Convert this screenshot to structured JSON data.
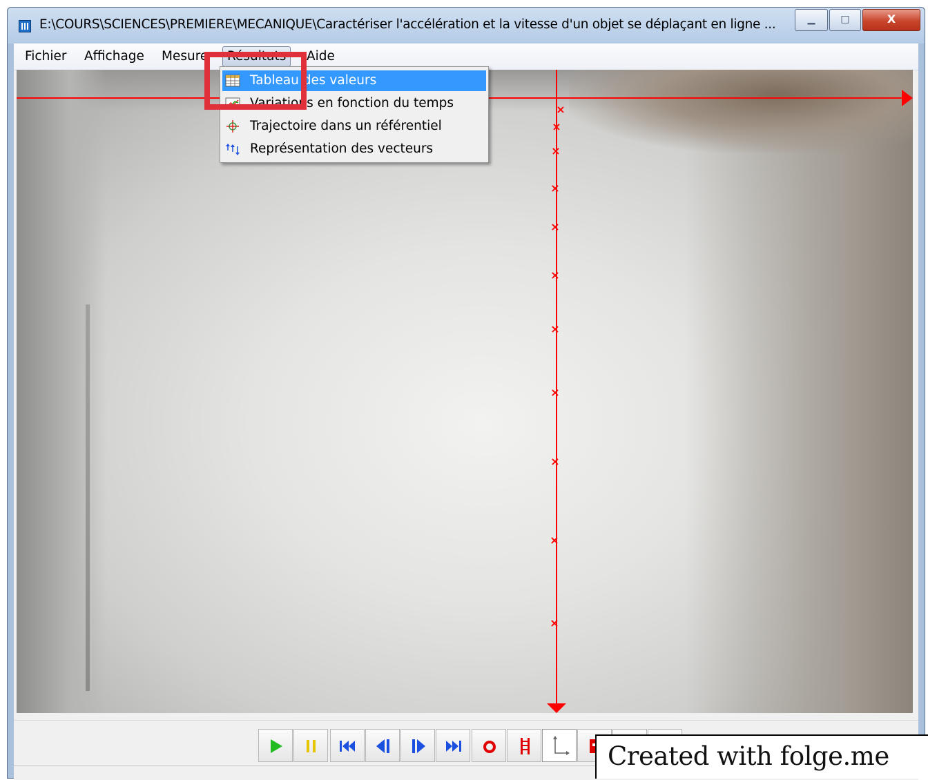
{
  "window": {
    "title": "E:\\COURS\\SCIENCES\\PREMIERE\\MECANIQUE\\Caractériser l'accélération et la vitesse d'un objet se déplaçant en ligne ...",
    "minimize_glyph": "▁",
    "maximize_glyph": "□",
    "close_glyph": "X"
  },
  "menubar": {
    "items": [
      {
        "label": "Fichier"
      },
      {
        "label": "Affichage"
      },
      {
        "label": "Mesure"
      },
      {
        "label": "Résultats",
        "state": "open"
      },
      {
        "label": "Aide"
      }
    ]
  },
  "dropdown": {
    "items": [
      {
        "label": "Tableau des valeurs",
        "icon": "table-icon",
        "highlighted": true
      },
      {
        "label": "Variations en fonction du temps",
        "icon": "graph-icon",
        "highlighted": false
      },
      {
        "label": "Trajectoire dans un référentiel",
        "icon": "trajectory-icon",
        "highlighted": false
      },
      {
        "label": "Représentation des vecteurs",
        "icon": "vectors-icon",
        "highlighted": false
      }
    ]
  },
  "annotation": {
    "color": "#e0303a"
  },
  "video": {
    "axis_color": "#ff0000",
    "marker": "×"
  },
  "toolbar": {
    "buttons": [
      {
        "name": "play-icon",
        "color": "#22bb22"
      },
      {
        "name": "pause-icon",
        "color": "#e6c600"
      },
      {
        "name": "first-frame-icon",
        "color": "#1a4fe0"
      },
      {
        "name": "previous-frame-icon",
        "color": "#1a4fe0"
      },
      {
        "name": "next-frame-icon",
        "color": "#1a4fe0"
      },
      {
        "name": "last-frame-icon",
        "color": "#1a4fe0"
      },
      {
        "name": "record-icon",
        "color": "#e00000"
      },
      {
        "name": "scale-icon",
        "color": "#e00000"
      },
      {
        "name": "axes-icon",
        "color": "#666666"
      },
      {
        "name": "clear-points-icon",
        "color": "#e00000"
      },
      {
        "name": "zoom-in-icon",
        "color": "#333333"
      },
      {
        "name": "zoom-out-icon",
        "color": "#333333"
      }
    ]
  },
  "watermark": {
    "text": "Created with folge.me"
  }
}
